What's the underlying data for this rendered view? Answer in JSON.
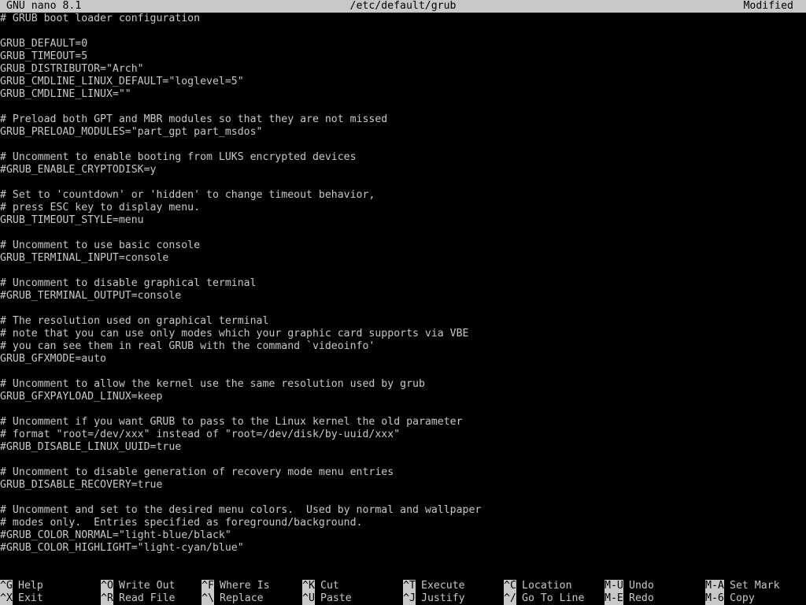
{
  "titlebar": {
    "app": "GNU nano 8.1",
    "file": "/etc/default/grub",
    "status": "Modified"
  },
  "editor": {
    "lines": [
      "# GRUB boot loader configuration",
      "",
      "GRUB_DEFAULT=0",
      "GRUB_TIMEOUT=5",
      "GRUB_DISTRIBUTOR=\"Arch\"",
      "GRUB_CMDLINE_LINUX_DEFAULT=\"loglevel=5\"",
      "GRUB_CMDLINE_LINUX=\"\"",
      "",
      "# Preload both GPT and MBR modules so that they are not missed",
      "GRUB_PRELOAD_MODULES=\"part_gpt part_msdos\"",
      "",
      "# Uncomment to enable booting from LUKS encrypted devices",
      "#GRUB_ENABLE_CRYPTODISK=y",
      "",
      "# Set to 'countdown' or 'hidden' to change timeout behavior,",
      "# press ESC key to display menu.",
      "GRUB_TIMEOUT_STYLE=menu",
      "",
      "# Uncomment to use basic console",
      "GRUB_TERMINAL_INPUT=console",
      "",
      "# Uncomment to disable graphical terminal",
      "#GRUB_TERMINAL_OUTPUT=console",
      "",
      "# The resolution used on graphical terminal",
      "# note that you can use only modes which your graphic card supports via VBE",
      "# you can see them in real GRUB with the command `videoinfo'",
      "GRUB_GFXMODE=auto",
      "",
      "# Uncomment to allow the kernel use the same resolution used by grub",
      "GRUB_GFXPAYLOAD_LINUX=keep",
      "",
      "# Uncomment if you want GRUB to pass to the Linux kernel the old parameter",
      "# format \"root=/dev/xxx\" instead of \"root=/dev/disk/by-uuid/xxx\"",
      "#GRUB_DISABLE_LINUX_UUID=true",
      "",
      "# Uncomment to disable generation of recovery mode menu entries",
      "GRUB_DISABLE_RECOVERY=true",
      "",
      "# Uncomment and set to the desired menu colors.  Used by normal and wallpaper",
      "# modes only.  Entries specified as foreground/background.",
      "#GRUB_COLOR_NORMAL=\"light-blue/black\"",
      "#GRUB_COLOR_HIGHLIGHT=\"light-cyan/blue\""
    ]
  },
  "shortcuts": {
    "row1": [
      {
        "key": "^G",
        "label": "Help"
      },
      {
        "key": "^O",
        "label": "Write Out"
      },
      {
        "key": "^F",
        "label": "Where Is"
      },
      {
        "key": "^K",
        "label": "Cut"
      },
      {
        "key": "^T",
        "label": "Execute"
      },
      {
        "key": "^C",
        "label": "Location"
      },
      {
        "key": "M-U",
        "label": "Undo"
      },
      {
        "key": "M-A",
        "label": "Set Mark"
      }
    ],
    "row2": [
      {
        "key": "^X",
        "label": "Exit"
      },
      {
        "key": "^R",
        "label": "Read File"
      },
      {
        "key": "^\\",
        "label": "Replace"
      },
      {
        "key": "^U",
        "label": "Paste"
      },
      {
        "key": "^J",
        "label": "Justify"
      },
      {
        "key": "^/",
        "label": "Go To Line"
      },
      {
        "key": "M-E",
        "label": "Redo"
      },
      {
        "key": "M-6",
        "label": "Copy"
      }
    ]
  },
  "colors": {
    "background": "#000000",
    "foreground": "#c8c8c8",
    "inverse_bg": "#c8c8c8",
    "inverse_fg": "#000000"
  }
}
